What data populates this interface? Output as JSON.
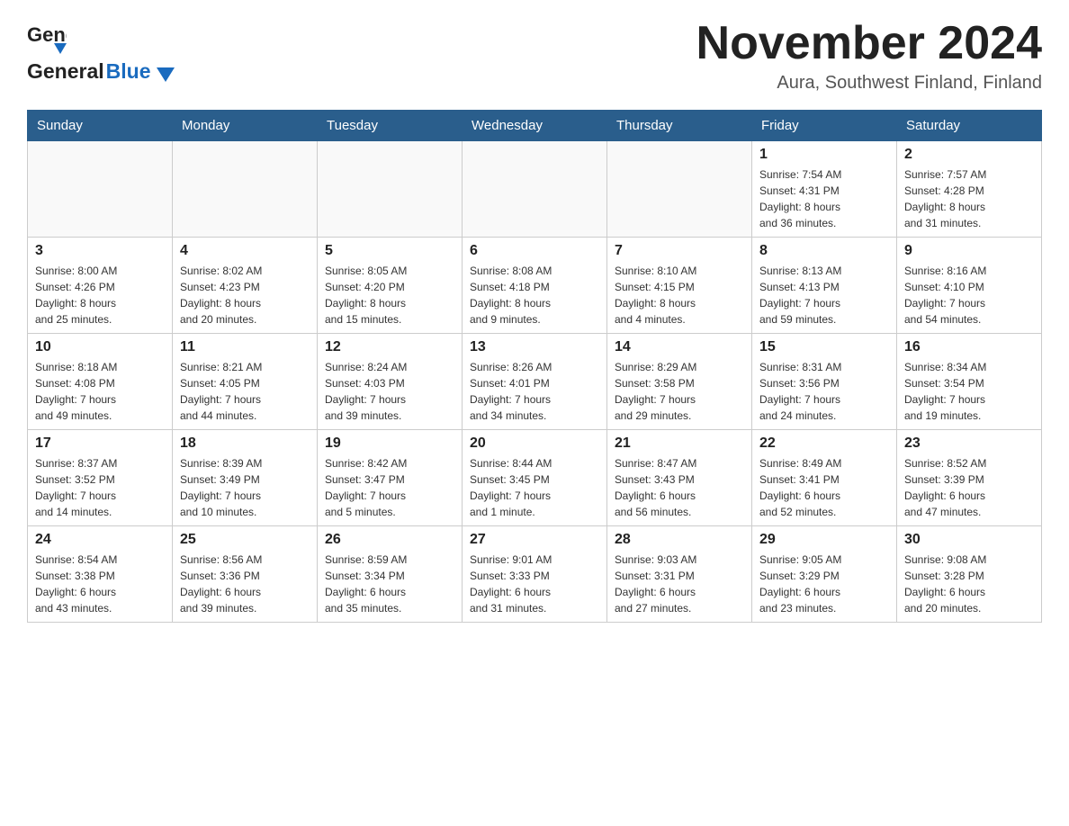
{
  "header": {
    "logo_general": "General",
    "logo_blue": "Blue",
    "month_year": "November 2024",
    "location": "Aura, Southwest Finland, Finland"
  },
  "weekdays": [
    "Sunday",
    "Monday",
    "Tuesday",
    "Wednesday",
    "Thursday",
    "Friday",
    "Saturday"
  ],
  "weeks": [
    [
      {
        "day": "",
        "info": ""
      },
      {
        "day": "",
        "info": ""
      },
      {
        "day": "",
        "info": ""
      },
      {
        "day": "",
        "info": ""
      },
      {
        "day": "",
        "info": ""
      },
      {
        "day": "1",
        "info": "Sunrise: 7:54 AM\nSunset: 4:31 PM\nDaylight: 8 hours\nand 36 minutes."
      },
      {
        "day": "2",
        "info": "Sunrise: 7:57 AM\nSunset: 4:28 PM\nDaylight: 8 hours\nand 31 minutes."
      }
    ],
    [
      {
        "day": "3",
        "info": "Sunrise: 8:00 AM\nSunset: 4:26 PM\nDaylight: 8 hours\nand 25 minutes."
      },
      {
        "day": "4",
        "info": "Sunrise: 8:02 AM\nSunset: 4:23 PM\nDaylight: 8 hours\nand 20 minutes."
      },
      {
        "day": "5",
        "info": "Sunrise: 8:05 AM\nSunset: 4:20 PM\nDaylight: 8 hours\nand 15 minutes."
      },
      {
        "day": "6",
        "info": "Sunrise: 8:08 AM\nSunset: 4:18 PM\nDaylight: 8 hours\nand 9 minutes."
      },
      {
        "day": "7",
        "info": "Sunrise: 8:10 AM\nSunset: 4:15 PM\nDaylight: 8 hours\nand 4 minutes."
      },
      {
        "day": "8",
        "info": "Sunrise: 8:13 AM\nSunset: 4:13 PM\nDaylight: 7 hours\nand 59 minutes."
      },
      {
        "day": "9",
        "info": "Sunrise: 8:16 AM\nSunset: 4:10 PM\nDaylight: 7 hours\nand 54 minutes."
      }
    ],
    [
      {
        "day": "10",
        "info": "Sunrise: 8:18 AM\nSunset: 4:08 PM\nDaylight: 7 hours\nand 49 minutes."
      },
      {
        "day": "11",
        "info": "Sunrise: 8:21 AM\nSunset: 4:05 PM\nDaylight: 7 hours\nand 44 minutes."
      },
      {
        "day": "12",
        "info": "Sunrise: 8:24 AM\nSunset: 4:03 PM\nDaylight: 7 hours\nand 39 minutes."
      },
      {
        "day": "13",
        "info": "Sunrise: 8:26 AM\nSunset: 4:01 PM\nDaylight: 7 hours\nand 34 minutes."
      },
      {
        "day": "14",
        "info": "Sunrise: 8:29 AM\nSunset: 3:58 PM\nDaylight: 7 hours\nand 29 minutes."
      },
      {
        "day": "15",
        "info": "Sunrise: 8:31 AM\nSunset: 3:56 PM\nDaylight: 7 hours\nand 24 minutes."
      },
      {
        "day": "16",
        "info": "Sunrise: 8:34 AM\nSunset: 3:54 PM\nDaylight: 7 hours\nand 19 minutes."
      }
    ],
    [
      {
        "day": "17",
        "info": "Sunrise: 8:37 AM\nSunset: 3:52 PM\nDaylight: 7 hours\nand 14 minutes."
      },
      {
        "day": "18",
        "info": "Sunrise: 8:39 AM\nSunset: 3:49 PM\nDaylight: 7 hours\nand 10 minutes."
      },
      {
        "day": "19",
        "info": "Sunrise: 8:42 AM\nSunset: 3:47 PM\nDaylight: 7 hours\nand 5 minutes."
      },
      {
        "day": "20",
        "info": "Sunrise: 8:44 AM\nSunset: 3:45 PM\nDaylight: 7 hours\nand 1 minute."
      },
      {
        "day": "21",
        "info": "Sunrise: 8:47 AM\nSunset: 3:43 PM\nDaylight: 6 hours\nand 56 minutes."
      },
      {
        "day": "22",
        "info": "Sunrise: 8:49 AM\nSunset: 3:41 PM\nDaylight: 6 hours\nand 52 minutes."
      },
      {
        "day": "23",
        "info": "Sunrise: 8:52 AM\nSunset: 3:39 PM\nDaylight: 6 hours\nand 47 minutes."
      }
    ],
    [
      {
        "day": "24",
        "info": "Sunrise: 8:54 AM\nSunset: 3:38 PM\nDaylight: 6 hours\nand 43 minutes."
      },
      {
        "day": "25",
        "info": "Sunrise: 8:56 AM\nSunset: 3:36 PM\nDaylight: 6 hours\nand 39 minutes."
      },
      {
        "day": "26",
        "info": "Sunrise: 8:59 AM\nSunset: 3:34 PM\nDaylight: 6 hours\nand 35 minutes."
      },
      {
        "day": "27",
        "info": "Sunrise: 9:01 AM\nSunset: 3:33 PM\nDaylight: 6 hours\nand 31 minutes."
      },
      {
        "day": "28",
        "info": "Sunrise: 9:03 AM\nSunset: 3:31 PM\nDaylight: 6 hours\nand 27 minutes."
      },
      {
        "day": "29",
        "info": "Sunrise: 9:05 AM\nSunset: 3:29 PM\nDaylight: 6 hours\nand 23 minutes."
      },
      {
        "day": "30",
        "info": "Sunrise: 9:08 AM\nSunset: 3:28 PM\nDaylight: 6 hours\nand 20 minutes."
      }
    ]
  ]
}
